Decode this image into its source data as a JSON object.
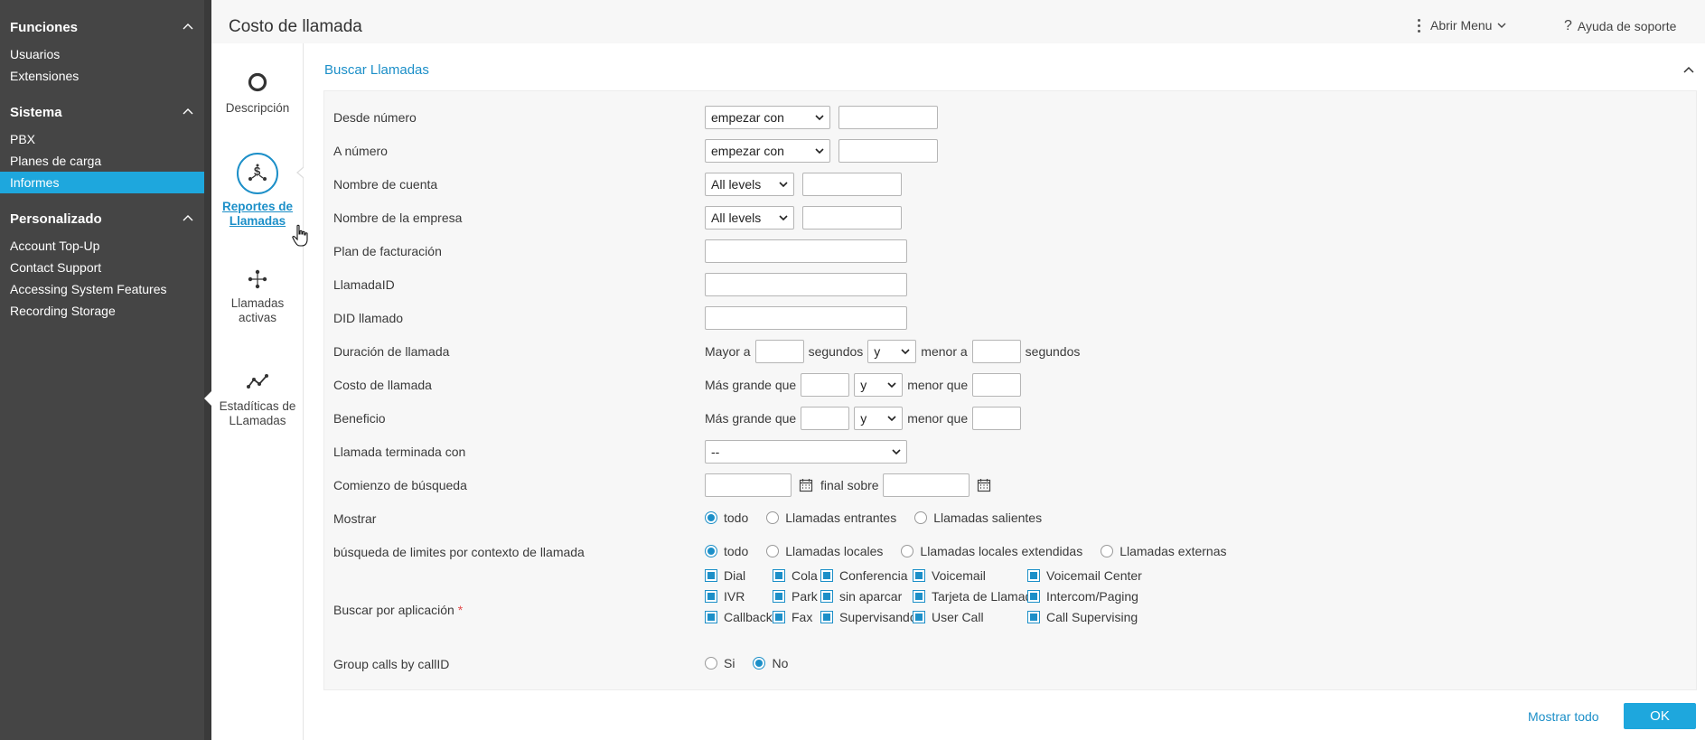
{
  "sidebar": {
    "sections": [
      {
        "title": "Funciones",
        "items": [
          "Usuarios",
          "Extensiones"
        ]
      },
      {
        "title": "Sistema",
        "items": [
          "PBX",
          "Planes de carga",
          "Informes"
        ]
      },
      {
        "title": "Personalizado",
        "items": [
          "Account Top-Up",
          "Contact Support",
          "Accessing System Features",
          "Recording Storage"
        ]
      }
    ],
    "active_item": "Informes"
  },
  "header": {
    "title": "Costo de llamada",
    "menu_label": "Abrir Menu",
    "help_label": "Ayuda de soporte"
  },
  "subnav": {
    "items": [
      {
        "label": "Descripción",
        "icon": "circle-icon"
      },
      {
        "label": "Reportes de Llamadas",
        "icon": "dollar-share-icon",
        "active": true
      },
      {
        "label": "Llamadas activas",
        "icon": "network-icon"
      },
      {
        "label": "Estadíticas de LLamadas",
        "icon": "line-chart-icon"
      }
    ]
  },
  "search": {
    "title": "Buscar Llamadas",
    "fields": {
      "desde_numero": {
        "label": "Desde número",
        "select": "empezar con",
        "value": ""
      },
      "a_numero": {
        "label": "A número",
        "select": "empezar con",
        "value": ""
      },
      "nombre_cuenta": {
        "label": "Nombre de cuenta",
        "select": "All levels",
        "value": ""
      },
      "nombre_empresa": {
        "label": "Nombre de la empresa",
        "select": "All levels",
        "value": ""
      },
      "plan_facturacion": {
        "label": "Plan de facturación",
        "value": ""
      },
      "llamada_id": {
        "label": "LlamadaID",
        "value": ""
      },
      "did_llamado": {
        "label": "DID llamado",
        "value": ""
      },
      "duracion": {
        "label": "Duración de llamada",
        "prefix": "Mayor a",
        "unit1": "segundos",
        "join": "y",
        "mid": "menor a",
        "unit2": "segundos"
      },
      "costo": {
        "label": "Costo de llamada",
        "prefix": "Más grande que",
        "join": "y",
        "mid": "menor que"
      },
      "beneficio": {
        "label": "Beneficio",
        "prefix": "Más grande que",
        "join": "y",
        "mid": "menor que"
      },
      "terminada": {
        "label": "Llamada terminada con",
        "select": "--"
      },
      "comienzo": {
        "label": "Comienzo de búsqueda",
        "mid": "final sobre"
      },
      "mostrar": {
        "label": "Mostrar",
        "options": [
          "todo",
          "Llamadas entrantes",
          "Llamadas salientes"
        ],
        "selected": "todo"
      },
      "contexto": {
        "label": "búsqueda de limites por contexto de llamada",
        "options": [
          "todo",
          "Llamadas locales",
          "Llamadas locales extendidas",
          "Llamadas externas"
        ],
        "selected": "todo"
      },
      "aplicacion": {
        "label": "Buscar por aplicación",
        "required_mark": "*",
        "apps": [
          [
            "Dial",
            "Cola",
            "Conferencia",
            "Voicemail",
            "Voicemail Center"
          ],
          [
            "IVR",
            "Park",
            "sin aparcar",
            "Tarjeta de Llamada",
            "Intercom/Paging"
          ],
          [
            "Callback",
            "Fax",
            "Supervisando",
            "User Call",
            "Call Supervising"
          ]
        ]
      },
      "group": {
        "label": "Group calls by callID",
        "options": [
          "Si",
          "No"
        ],
        "selected": "No"
      }
    }
  },
  "footer": {
    "show_all": "Mostrar todo",
    "ok": "OK"
  },
  "colors": {
    "accent": "#1ea7dd",
    "link": "#1c8fc8",
    "sidebar_bg": "#454545"
  }
}
